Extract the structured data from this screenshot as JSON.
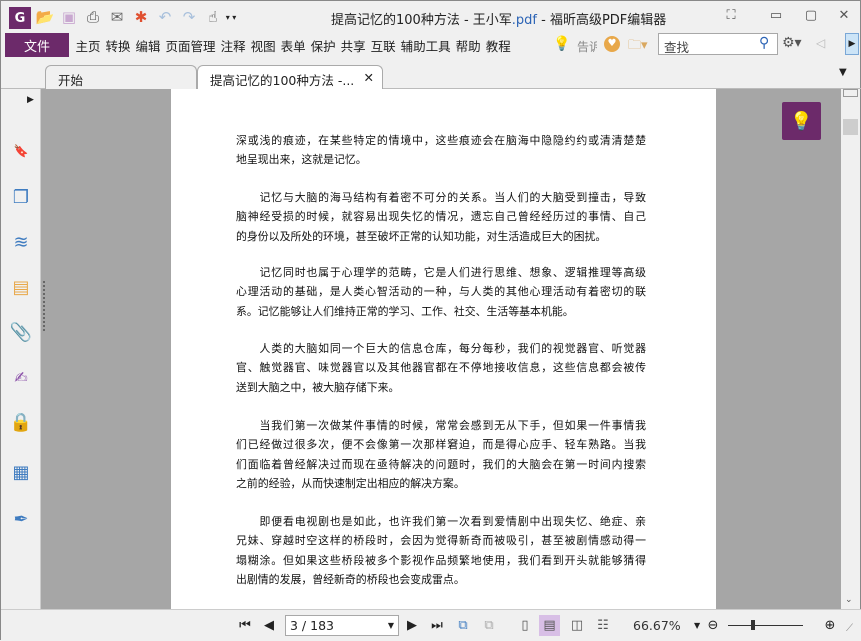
{
  "window": {
    "title_prefix": "提高记忆的100种方法 - 王小军",
    "title_ext": ".pdf",
    "title_suffix": " - 福昕高级PDF编辑器"
  },
  "menu": {
    "file": "文件",
    "items": [
      "主页",
      "转换",
      "编辑",
      "页面管理",
      "注释",
      "视图",
      "表单",
      "保护",
      "共享",
      "互联",
      "辅助工具",
      "帮助",
      "教程"
    ],
    "tell_me": "告诉",
    "search_placeholder": "查找"
  },
  "tabs": [
    {
      "label": "开始"
    },
    {
      "label": "提高记忆的100种方法 -..."
    }
  ],
  "document": {
    "paragraphs": [
      [
        "深或浅的痕迹，在某些特定的情境中，这些痕迹会在脑海中隐隐约约或清清楚楚",
        "地呈现出来，这就是记忆。"
      ],
      [
        "　　记忆与大脑的海马结构有着密不可分的关系。当人们的大脑受到撞击，导致",
        "脑神经受损的时候，就容易出现失忆的情况，遗忘自己曾经经历过的事情、自己",
        "的身份以及所处的环境，甚至破坏正常的认知功能，对生活造成巨大的困扰。"
      ],
      [
        "　　记忆同时也属于心理学的范畴，它是人们进行思维、想象、逻辑推理等高级",
        "心理活动的基础，是人类心智活动的一种，与人类的其他心理活动有着密切的联",
        "系。记忆能够让人们维持正常的学习、工作、社交、生活等基本机能。"
      ],
      [
        "　　人类的大脑如同一个巨大的信息仓库，每分每秒，我们的视觉器官、听觉器",
        "官、触觉器官、味觉器官以及其他器官都在不停地接收信息，这些信息都会被传",
        "送到大脑之中，被大脑存储下来。"
      ],
      [
        "　　当我们第一次做某件事情的时候，常常会感到无从下手，但如果一件事情我",
        "们已经做过很多次，便不会像第一次那样窘迫，而是得心应手、轻车熟路。当我",
        "们面临着曾经解决过而现在亟待解决的问题时，我们的大脑会在第一时间内搜索",
        "之前的经验，从而快速制定出相应的解决方案。"
      ],
      [
        "　　即便看电视剧也是如此，也许我们第一次看到爱情剧中出现失忆、绝症、亲",
        "兄妹、穿越时空这样的桥段时，会因为觉得新奇而被吸引，甚至被剧情感动得一",
        "塌糊涂。但如果这些桥段被多个影视作品频繁地使用，我们看到开头就能够猜得",
        "出剧情的发展，曾经新奇的桥段也会变成雷点。"
      ]
    ]
  },
  "status": {
    "page": "3 / 183",
    "zoom": "66.67%",
    "zoom_slider_fraction": 0.33
  },
  "colors": {
    "accent": "#6c2a6a",
    "viewer_bg": "#a6a6a6"
  }
}
